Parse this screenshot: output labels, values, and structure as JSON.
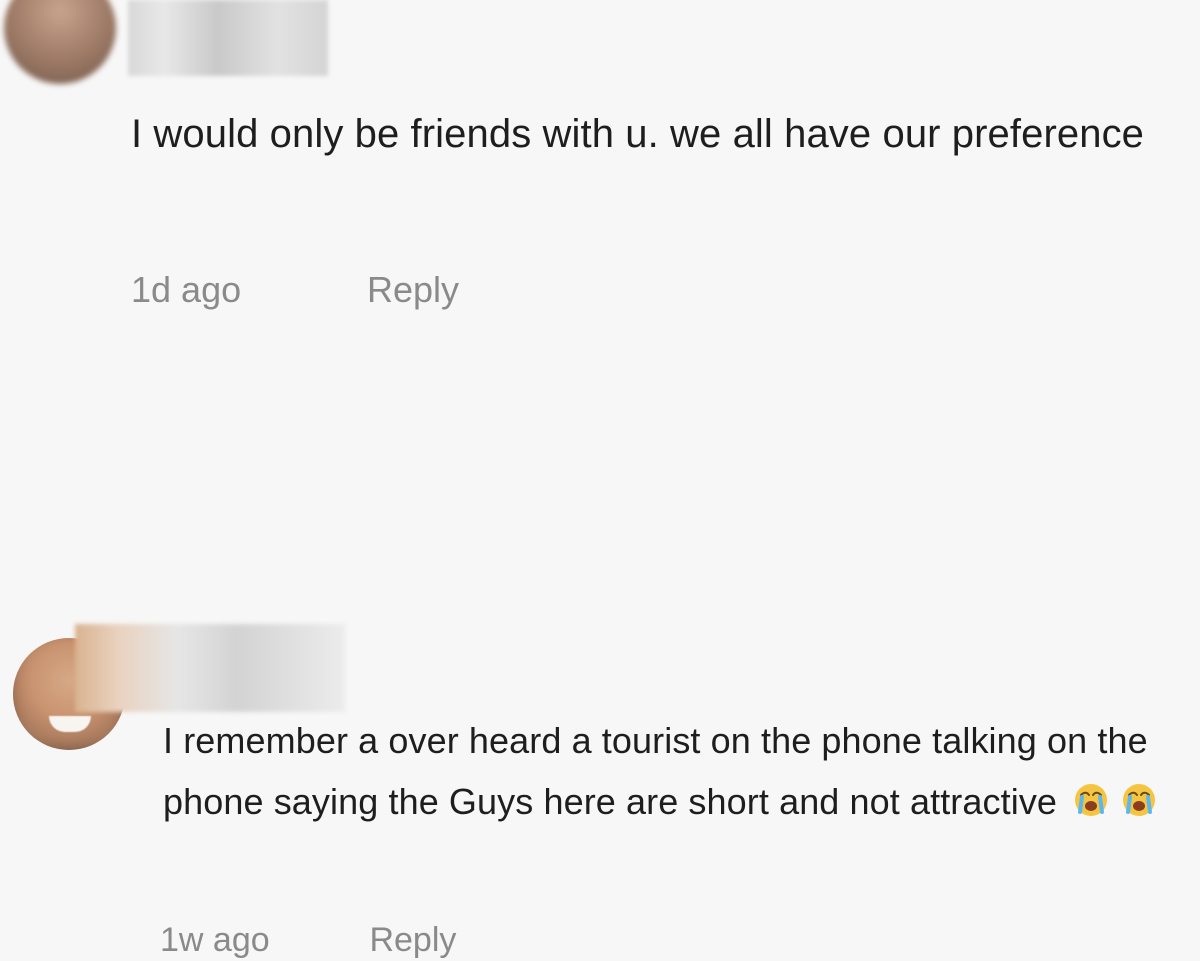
{
  "comments": [
    {
      "text": "I would only be friends with u. we all have our preference",
      "time": "1d ago",
      "reply_label": "Reply"
    },
    {
      "text": "I remember a over heard a tourist on the phone talking on the phone saying the Guys here are short and not attractive",
      "emoji_icons": [
        "loudly-crying-face-emoji",
        "loudly-crying-face-emoji"
      ],
      "time": "1w ago",
      "reply_label": "Reply"
    }
  ],
  "colors": {
    "background": "#f7f7f7",
    "text": "#1e1e1e",
    "meta": "#8a8a8a",
    "emoji": "#f5c542"
  }
}
